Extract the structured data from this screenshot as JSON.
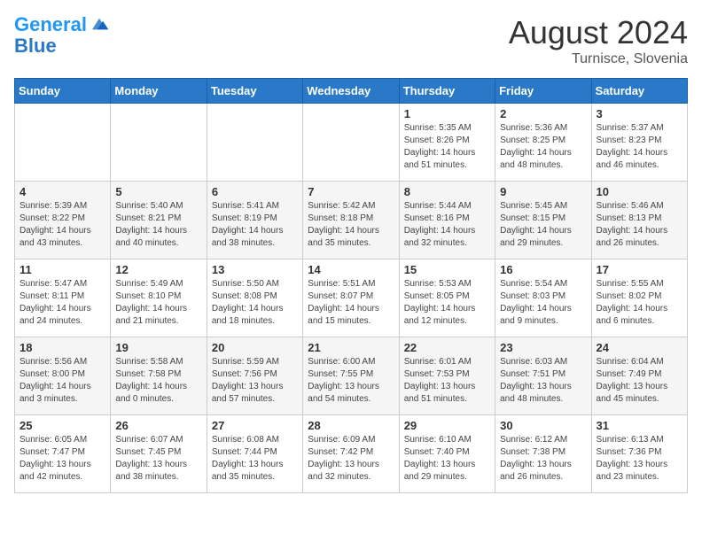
{
  "header": {
    "logo_line1": "General",
    "logo_line2": "Blue",
    "month_year": "August 2024",
    "location": "Turnisce, Slovenia"
  },
  "weekdays": [
    "Sunday",
    "Monday",
    "Tuesday",
    "Wednesday",
    "Thursday",
    "Friday",
    "Saturday"
  ],
  "weeks": [
    [
      {
        "day": "",
        "info": ""
      },
      {
        "day": "",
        "info": ""
      },
      {
        "day": "",
        "info": ""
      },
      {
        "day": "",
        "info": ""
      },
      {
        "day": "1",
        "info": "Sunrise: 5:35 AM\nSunset: 8:26 PM\nDaylight: 14 hours\nand 51 minutes."
      },
      {
        "day": "2",
        "info": "Sunrise: 5:36 AM\nSunset: 8:25 PM\nDaylight: 14 hours\nand 48 minutes."
      },
      {
        "day": "3",
        "info": "Sunrise: 5:37 AM\nSunset: 8:23 PM\nDaylight: 14 hours\nand 46 minutes."
      }
    ],
    [
      {
        "day": "4",
        "info": "Sunrise: 5:39 AM\nSunset: 8:22 PM\nDaylight: 14 hours\nand 43 minutes."
      },
      {
        "day": "5",
        "info": "Sunrise: 5:40 AM\nSunset: 8:21 PM\nDaylight: 14 hours\nand 40 minutes."
      },
      {
        "day": "6",
        "info": "Sunrise: 5:41 AM\nSunset: 8:19 PM\nDaylight: 14 hours\nand 38 minutes."
      },
      {
        "day": "7",
        "info": "Sunrise: 5:42 AM\nSunset: 8:18 PM\nDaylight: 14 hours\nand 35 minutes."
      },
      {
        "day": "8",
        "info": "Sunrise: 5:44 AM\nSunset: 8:16 PM\nDaylight: 14 hours\nand 32 minutes."
      },
      {
        "day": "9",
        "info": "Sunrise: 5:45 AM\nSunset: 8:15 PM\nDaylight: 14 hours\nand 29 minutes."
      },
      {
        "day": "10",
        "info": "Sunrise: 5:46 AM\nSunset: 8:13 PM\nDaylight: 14 hours\nand 26 minutes."
      }
    ],
    [
      {
        "day": "11",
        "info": "Sunrise: 5:47 AM\nSunset: 8:11 PM\nDaylight: 14 hours\nand 24 minutes."
      },
      {
        "day": "12",
        "info": "Sunrise: 5:49 AM\nSunset: 8:10 PM\nDaylight: 14 hours\nand 21 minutes."
      },
      {
        "day": "13",
        "info": "Sunrise: 5:50 AM\nSunset: 8:08 PM\nDaylight: 14 hours\nand 18 minutes."
      },
      {
        "day": "14",
        "info": "Sunrise: 5:51 AM\nSunset: 8:07 PM\nDaylight: 14 hours\nand 15 minutes."
      },
      {
        "day": "15",
        "info": "Sunrise: 5:53 AM\nSunset: 8:05 PM\nDaylight: 14 hours\nand 12 minutes."
      },
      {
        "day": "16",
        "info": "Sunrise: 5:54 AM\nSunset: 8:03 PM\nDaylight: 14 hours\nand 9 minutes."
      },
      {
        "day": "17",
        "info": "Sunrise: 5:55 AM\nSunset: 8:02 PM\nDaylight: 14 hours\nand 6 minutes."
      }
    ],
    [
      {
        "day": "18",
        "info": "Sunrise: 5:56 AM\nSunset: 8:00 PM\nDaylight: 14 hours\nand 3 minutes."
      },
      {
        "day": "19",
        "info": "Sunrise: 5:58 AM\nSunset: 7:58 PM\nDaylight: 14 hours\nand 0 minutes."
      },
      {
        "day": "20",
        "info": "Sunrise: 5:59 AM\nSunset: 7:56 PM\nDaylight: 13 hours\nand 57 minutes."
      },
      {
        "day": "21",
        "info": "Sunrise: 6:00 AM\nSunset: 7:55 PM\nDaylight: 13 hours\nand 54 minutes."
      },
      {
        "day": "22",
        "info": "Sunrise: 6:01 AM\nSunset: 7:53 PM\nDaylight: 13 hours\nand 51 minutes."
      },
      {
        "day": "23",
        "info": "Sunrise: 6:03 AM\nSunset: 7:51 PM\nDaylight: 13 hours\nand 48 minutes."
      },
      {
        "day": "24",
        "info": "Sunrise: 6:04 AM\nSunset: 7:49 PM\nDaylight: 13 hours\nand 45 minutes."
      }
    ],
    [
      {
        "day": "25",
        "info": "Sunrise: 6:05 AM\nSunset: 7:47 PM\nDaylight: 13 hours\nand 42 minutes."
      },
      {
        "day": "26",
        "info": "Sunrise: 6:07 AM\nSunset: 7:45 PM\nDaylight: 13 hours\nand 38 minutes."
      },
      {
        "day": "27",
        "info": "Sunrise: 6:08 AM\nSunset: 7:44 PM\nDaylight: 13 hours\nand 35 minutes."
      },
      {
        "day": "28",
        "info": "Sunrise: 6:09 AM\nSunset: 7:42 PM\nDaylight: 13 hours\nand 32 minutes."
      },
      {
        "day": "29",
        "info": "Sunrise: 6:10 AM\nSunset: 7:40 PM\nDaylight: 13 hours\nand 29 minutes."
      },
      {
        "day": "30",
        "info": "Sunrise: 6:12 AM\nSunset: 7:38 PM\nDaylight: 13 hours\nand 26 minutes."
      },
      {
        "day": "31",
        "info": "Sunrise: 6:13 AM\nSunset: 7:36 PM\nDaylight: 13 hours\nand 23 minutes."
      }
    ]
  ]
}
